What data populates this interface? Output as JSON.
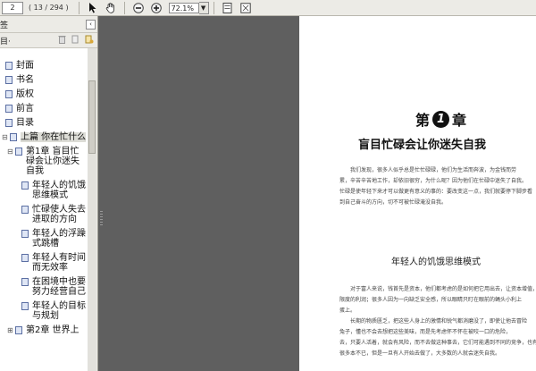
{
  "toolbar": {
    "page_current": "2",
    "page_count": "( 13 / 294 )",
    "zoom": "72.1%"
  },
  "panel": {
    "header_label": "签",
    "tools_left": "目·"
  },
  "bookmarks": {
    "top": [
      "封面",
      "书名",
      "版权",
      "前言",
      "目录"
    ],
    "part1": "上篇 你在忙什么",
    "chapter1": "第1章 盲目忙碌会让你迷失自我",
    "sub": [
      "年轻人的饥饿思维模式",
      "忙碌使人失去进取的方向",
      "年轻人的浮躁式跳槽",
      "年轻人有时间而无效率",
      "在困境中也要努力经营自己",
      "年轻人的目标与规划"
    ],
    "chapter2": "第2章 世界上"
  },
  "page": {
    "chapter_prefix": "第",
    "chapter_number": "1",
    "chapter_suffix": "章",
    "chapter_subtitle": "盲目忙碌会让你迷失自我",
    "section_title": "年轻人的饥饿思维模式",
    "para1": [
      "我们发现，很多人似乎总是忙忙碌碌，他们为生活而奔波，为金钱而劳",
      "累，",
      "辛苦辛苦地工作，却依旧很穷，为什么呢？因为他们在忙碌中迷失了自我。",
      "忙碌是使年轻下来才可以做更有意义的事的：要改变这一点，我们就要停下脚步看",
      "到自己奋斗的方向，切不可被忙碌淹没自我。"
    ],
    "para2": [
      "对于富人来说，钱首先是资本，他们都考虑的是如何把它用出去，让资本增值，",
      "限度的利润；很多人因为一向缺乏安全感，所以眼睛只盯在眼前的蝇头小利上",
      "蛋上。",
      "长期的物质匮乏，把这些人身上的激情和锐气都消磨没了，即使让他去冒险",
      "兔子，懂也不会去想把这些美味，而是先考虑怀不怀在被咬一口的危险，",
      "去，只要人活着，就会有风险，而不去做这种事去，它们可能遇到不同的竞争，也有",
      "很多本不已，但是一旦有人开始去做了，大多数的人就会迷失自我。"
    ]
  }
}
